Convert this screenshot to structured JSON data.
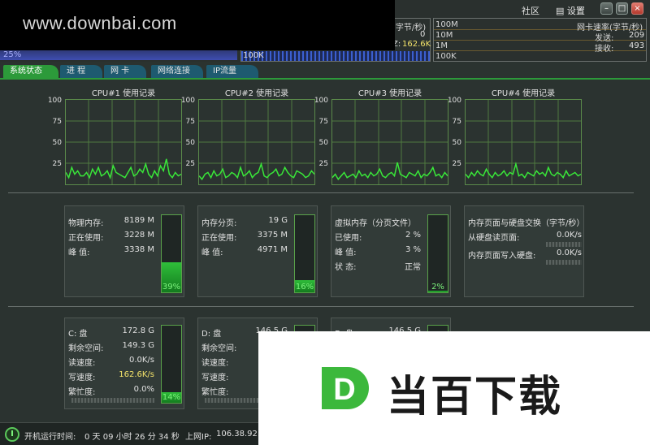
{
  "watermark": "www.downbai.com",
  "titlebar": {
    "community": "社区",
    "settings": "设置",
    "settings_icon": "settings-list-icon"
  },
  "cpu_strip": {
    "percent": "25%"
  },
  "net_mid": {
    "label1": "(字节/秒)",
    "val1": "0",
    "label2": "Z:",
    "val2": "162.6K",
    "val2_color": "#f2e26a",
    "scale": "100K"
  },
  "net_right": {
    "title": "网卡速率(字节/秒)",
    "scale_top": "100M",
    "scale_2": "10M",
    "scale_3": "1M",
    "scale_4": "100K",
    "send_label": "发送:",
    "send_value": "209",
    "recv_label": "接收:",
    "recv_value": "493"
  },
  "tabs": [
    "系统状态",
    "进  程",
    "网  卡",
    "网络连接",
    "IP流量"
  ],
  "accent_green": "#2c9a3a",
  "tab_blue": "#1e5a70",
  "cpus": [
    {
      "title": "CPU#1 使用记录",
      "ticks": [
        "100",
        "75",
        "50",
        "25"
      ],
      "history": [
        14,
        8,
        20,
        12,
        16,
        10,
        10,
        14,
        8,
        18,
        12,
        20,
        10,
        12,
        16,
        8,
        22,
        14,
        12,
        10,
        8,
        14,
        20,
        10,
        12,
        18,
        14,
        24,
        12,
        8,
        16,
        10,
        22,
        16,
        30,
        12,
        8,
        14,
        10,
        12
      ]
    },
    {
      "title": "CPU#2 使用记录",
      "ticks": [
        "100",
        "75",
        "50",
        "25"
      ],
      "history": [
        10,
        6,
        12,
        14,
        8,
        16,
        10,
        12,
        18,
        8,
        10,
        14,
        12,
        8,
        20,
        10,
        12,
        16,
        8,
        12,
        14,
        24,
        10,
        8,
        12,
        14,
        18,
        10,
        12,
        20,
        14,
        10,
        8,
        16,
        14,
        12,
        8,
        10,
        16,
        12
      ]
    },
    {
      "title": "CPU#3 使用记录",
      "ticks": [
        "100",
        "75",
        "50",
        "25"
      ],
      "history": [
        8,
        12,
        6,
        10,
        14,
        8,
        10,
        12,
        8,
        16,
        10,
        12,
        8,
        14,
        10,
        12,
        18,
        10,
        8,
        12,
        14,
        10,
        26,
        12,
        10,
        8,
        14,
        12,
        10,
        16,
        8,
        12,
        10,
        14,
        20,
        10,
        12,
        8,
        14,
        10
      ]
    },
    {
      "title": "CPU#4 使用记录",
      "ticks": [
        "100",
        "75",
        "50",
        "25"
      ],
      "history": [
        12,
        8,
        14,
        10,
        16,
        12,
        10,
        18,
        12,
        8,
        14,
        10,
        12,
        16,
        10,
        14,
        12,
        24,
        10,
        12,
        8,
        14,
        12,
        10,
        16,
        12,
        14,
        10,
        20,
        12,
        10,
        14,
        12,
        8,
        16,
        10,
        12,
        14,
        10,
        12
      ]
    }
  ],
  "memory": {
    "rows": [
      {
        "label": "物理内存:",
        "value": "8189 M"
      },
      {
        "label": "正在使用:",
        "value": "3228 M"
      },
      {
        "label": "峰    值:",
        "value": "3338 M"
      }
    ],
    "percent": "39%",
    "fraction": 0.39
  },
  "paging": {
    "rows": [
      {
        "label": "内存分页:",
        "value": "19 G"
      },
      {
        "label": "正在使用:",
        "value": "3375 M"
      },
      {
        "label": "峰    值:",
        "value": "4971 M"
      }
    ],
    "percent": "16%",
    "fraction": 0.16
  },
  "virtual": {
    "title": "虚拟内存（分页文件）",
    "rows": [
      {
        "label": "已使用:",
        "value": "2 %"
      },
      {
        "label": "峰    值:",
        "value": "3 %"
      },
      {
        "label": "状    态:",
        "value": "正常"
      }
    ],
    "percent": "2%",
    "fraction": 0.02
  },
  "swap": {
    "title": "内存页面与硬盘交换（字节/秒）",
    "read_label": "从硬盘读页面:",
    "read_value": "0.0K/s",
    "write_label": "内存页面写入硬盘:",
    "write_value": "0.0K/s"
  },
  "disk_c": {
    "rows": [
      {
        "label": "C: 盘",
        "value": "172.8 G"
      },
      {
        "label": "剩余空间:",
        "value": "149.3 G"
      },
      {
        "label": "读速度:",
        "value": "0.0K/s"
      },
      {
        "label": "写速度:",
        "value": "162.6K/s"
      },
      {
        "label": "繁忙度:",
        "value": "0.0%"
      }
    ],
    "percent": "14%",
    "fraction": 0.14
  },
  "disk_d": {
    "rows": [
      {
        "label": "D: 盘",
        "value": "146.5 G"
      },
      {
        "label": "剩余空间:",
        "value": ""
      },
      {
        "label": "读速度:",
        "value": ""
      },
      {
        "label": "写速度:",
        "value": ""
      },
      {
        "label": "繁忙度:",
        "value": ""
      }
    ]
  },
  "disk_e": {
    "rows": [
      {
        "label": "E: 盘",
        "value": "146.5 G"
      }
    ]
  },
  "status": {
    "uptime_label": "开机运行时间:",
    "uptime_value": "0 天 09 小时 26 分 34 秒",
    "ip_label": "上网IP:",
    "ip_value": "106.38.92."
  },
  "brand": {
    "logo_letter": "D",
    "text": "当百下载",
    "color": "#3cb83c"
  }
}
